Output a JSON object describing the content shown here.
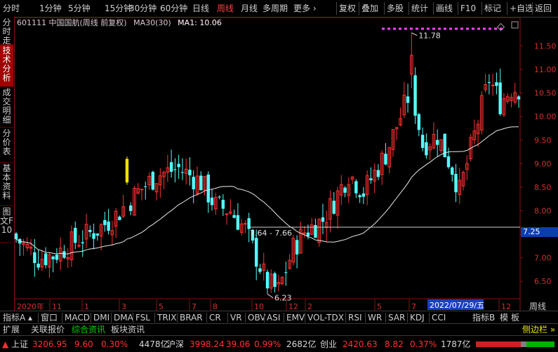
{
  "toolbar": {
    "left": [
      "分时",
      "1分钟",
      "5分钟",
      "15分钟",
      "30分钟",
      "60分钟",
      "日线",
      "周线",
      "月线",
      "多周期",
      "更多 ›"
    ],
    "active_index": 7,
    "right": [
      "复权",
      "叠加",
      "多股",
      "统计",
      "画线",
      "F10",
      "标记",
      "+自选",
      "返回"
    ]
  },
  "sidebar": {
    "tabs": [
      "分时走势",
      "技术分析",
      "成交明细",
      "分价表",
      "基本资料",
      "图文F10"
    ],
    "active_index": 1
  },
  "title": {
    "code_name": "601111 中国国航(周线 前复权)",
    "ma30": "MA30(30)",
    "ma1": "MA1: 10.06"
  },
  "chart_data": {
    "type": "candlestick",
    "y_ticks": [
      "11.50",
      "11.00",
      "10.50",
      "10.00",
      "9.50",
      "9.00",
      "8.50",
      "8.00",
      "7.50",
      "7.00",
      "6.50"
    ],
    "ylim": [
      6.13,
      11.85
    ],
    "x_ticks": [
      "2020年",
      "11",
      "1",
      "3",
      "5",
      "7",
      "8",
      "10",
      "12",
      "2",
      "5",
      "7",
      "12"
    ],
    "annotations": {
      "high": "11.78",
      "low": "6.23",
      "range": "7.64 - 7.66"
    },
    "current_price": "7.25",
    "date_box": "2022/07/29/五",
    "period_label": "周线"
  },
  "indicators": {
    "left_label": "指标A",
    "items": [
      "窗口",
      "MACD",
      "DMI",
      "DMA",
      "FSL",
      "TRIX",
      "BRAR",
      "CR",
      "VR",
      "OBV",
      "ASI",
      "EMV",
      "VOL-TDX",
      "RSI",
      "WR",
      "SAR",
      "KDJ",
      "CCI"
    ],
    "right_label": "指标B",
    "right_items": [
      "模",
      "板"
    ]
  },
  "bottom_tabs": {
    "items": [
      "扩展",
      "关联报价",
      "综合资讯",
      "板块资讯"
    ],
    "right": "侧边栏 »"
  },
  "status": {
    "sh_name": "上证",
    "sh_val": "3206.95",
    "sh_chg": "9.60",
    "sh_pct": "0.30%",
    "sh_amt": "4478亿",
    "sz_name": "沪深",
    "sz_val": "3998.24",
    "sz_chg": "39.06",
    "sz_pct": "0.99%",
    "sz_amt": "2682亿",
    "cy_name": "创业",
    "cy_val": "2420.63",
    "cy_chg": "8.82",
    "cy_pct": "0.37%",
    "cy_amt": "1787亿"
  }
}
